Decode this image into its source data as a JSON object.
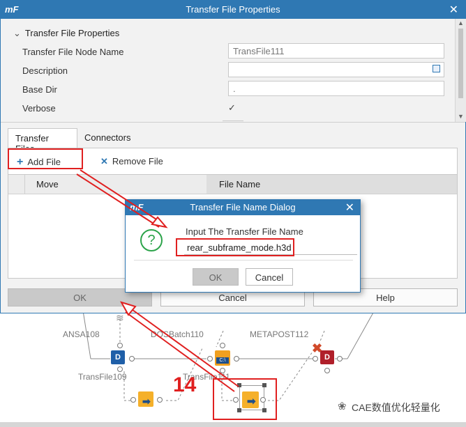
{
  "main_dialog": {
    "logo": "mF",
    "title": "Transfer File Properties",
    "section_title": "Transfer File Properties",
    "fields": [
      {
        "label": "Transfer File Node Name",
        "value": "TransFile111"
      },
      {
        "label": "Description",
        "value": ""
      },
      {
        "label": "Base Dir",
        "value": "."
      },
      {
        "label": "Verbose",
        "checked": true
      }
    ],
    "tabs": [
      "Transfer Files",
      "Connectors"
    ],
    "toolbar": {
      "add_file": "Add File",
      "remove_file": "Remove File"
    },
    "table_headers": [
      "Move",
      "File Name"
    ],
    "buttons": {
      "ok": "OK",
      "cancel": "Cancel",
      "help": "Help"
    }
  },
  "name_dialog": {
    "logo": "mF",
    "title": "Transfer File Name Dialog",
    "prompt": "Input The Transfer File Name",
    "input_value": "rear_subframe_mode.h3d",
    "buttons": {
      "ok": "OK",
      "cancel": "Cancel"
    }
  },
  "workflow": {
    "nodes": [
      {
        "label": "ANSA108",
        "icon": "ansa-node-icon"
      },
      {
        "label": "DOSBatch110",
        "icon": "dos-batch-icon"
      },
      {
        "label": "METAPOST112",
        "icon": "metapost-icon"
      },
      {
        "label": "TransFile109",
        "icon": "transfer-file-icon"
      },
      {
        "label": "TransFile111",
        "icon": "transfer-file-icon"
      }
    ],
    "step_number": "14"
  },
  "watermark": "CAE数值优化轻量化",
  "colors": {
    "title_bar": "#2f78b3",
    "highlight": "#e02020",
    "question": "#2ca34a"
  }
}
